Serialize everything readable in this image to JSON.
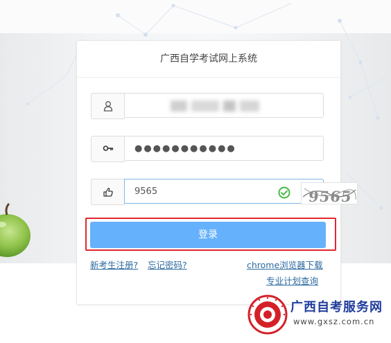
{
  "header": {
    "title": "广西自学考试网上系统"
  },
  "form": {
    "username": {
      "icon": "user-icon"
    },
    "password": {
      "icon": "key-icon",
      "masked_value": "●●●●●●●●●●●"
    },
    "captcha": {
      "icon": "pointing-hand-icon",
      "value": "9565",
      "image_code": "9565",
      "status_icon": "check-circle-icon"
    },
    "login_label": "登录"
  },
  "links": {
    "register": "新考生注册?",
    "forgot_password": "忘记密码?",
    "chrome_download": "chrome浏览器下载",
    "plan_query": "专业计划查询"
  },
  "watermark": {
    "title": "广西自考服务网",
    "url": "www.gxsz.com.cn",
    "seal_text": "广西自考服务网"
  },
  "colors": {
    "login_button": "#66b1fc",
    "highlight_border": "#e2262f",
    "link": "#2c6aa0",
    "check_green": "#46b946",
    "watermark_blue": "#1f3c9c",
    "seal_red": "#d42028"
  }
}
